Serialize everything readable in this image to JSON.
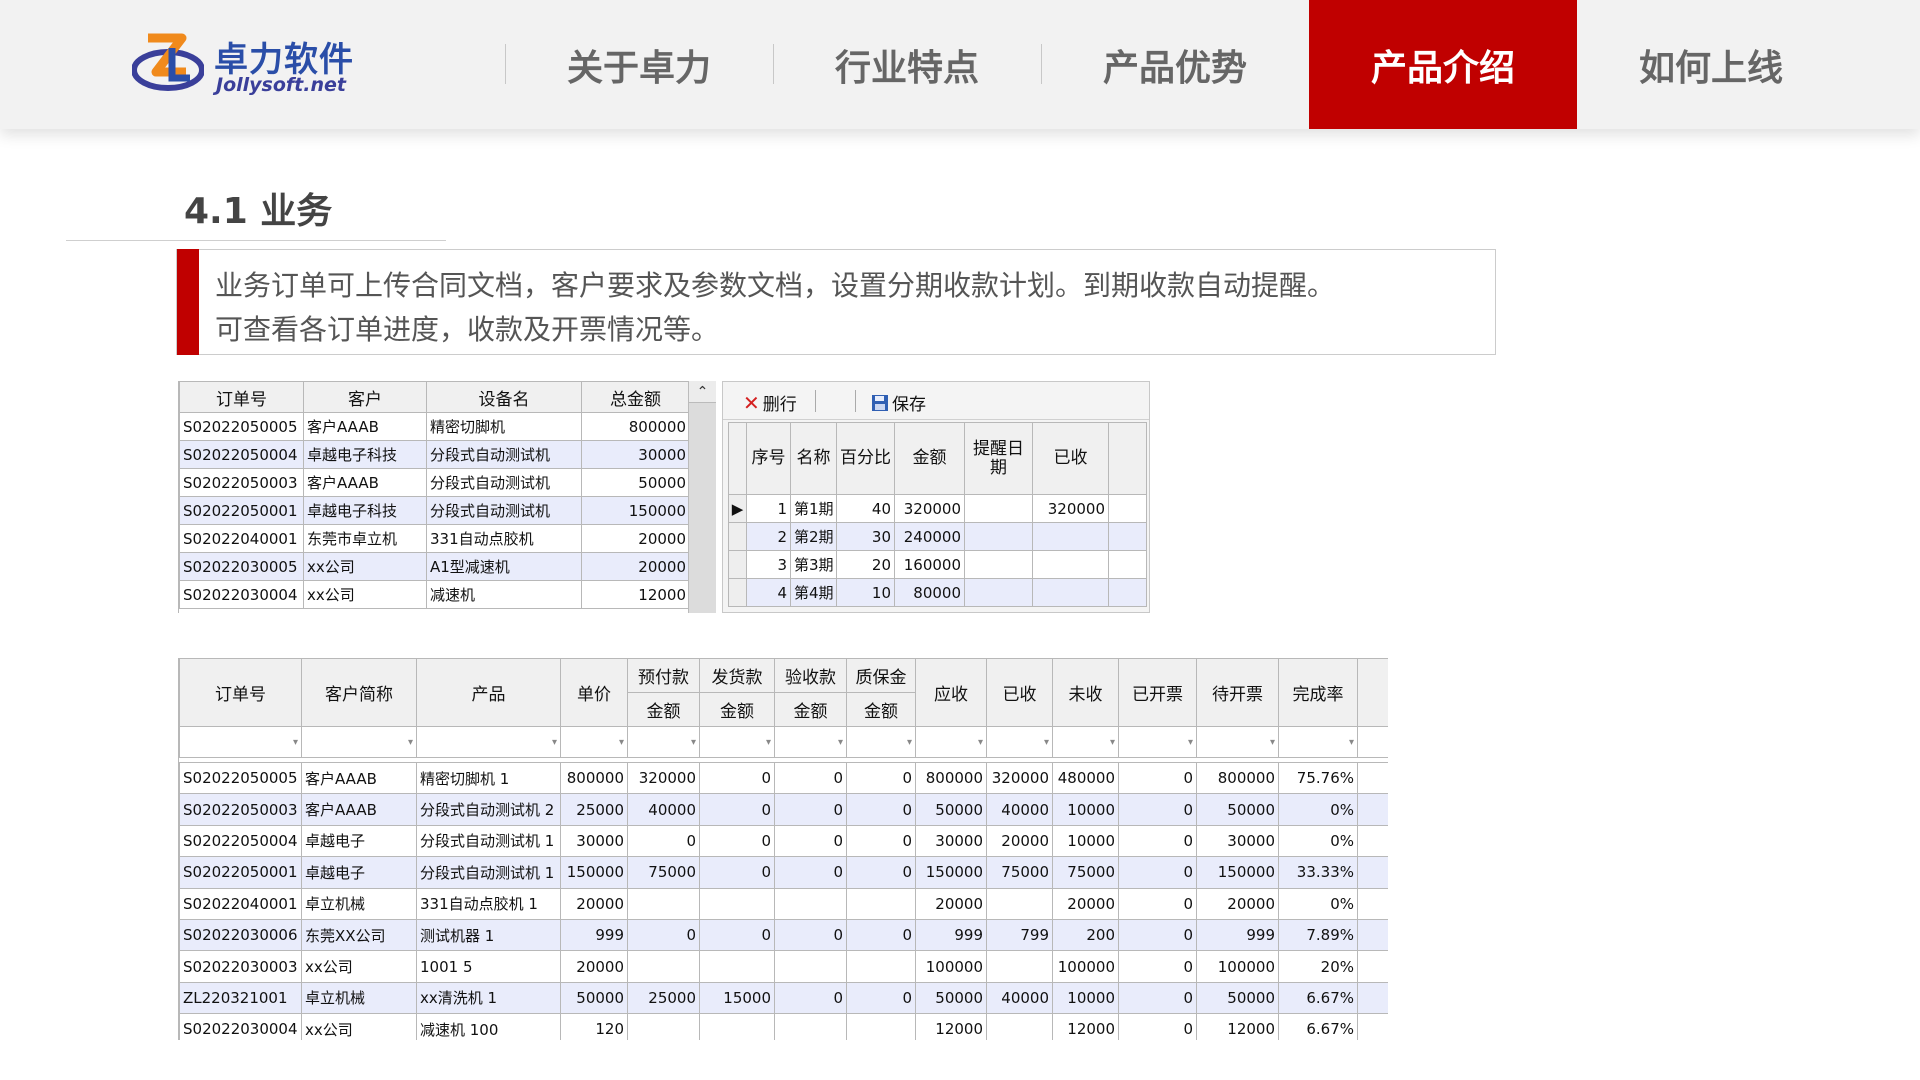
{
  "brand": {
    "name_cn": "卓力软件",
    "name_en": "Jollysoft.net"
  },
  "nav": [
    {
      "label": "关于卓力",
      "active": false
    },
    {
      "label": "行业特点",
      "active": false
    },
    {
      "label": "产品优势",
      "active": false
    },
    {
      "label": "产品介绍",
      "active": true
    },
    {
      "label": "如何上线",
      "active": false
    }
  ],
  "section": {
    "title": "4.1 业务",
    "desc_line1": "业务订单可上传合同文档，客户要求及参数文档，设置分期收款计划。到期收款自动提醒。",
    "desc_line2": "可查看各订单进度，收款及开票情况等。"
  },
  "orders_table": {
    "headers": [
      "订单号",
      "客户",
      "设备名",
      "总金额"
    ],
    "rows": [
      [
        "S02022050005",
        "客户AAAB",
        "精密切脚机",
        "800000"
      ],
      [
        "S02022050004",
        "卓越电子科技",
        "分段式自动测试机",
        "30000"
      ],
      [
        "S02022050003",
        "客户AAAB",
        "分段式自动测试机",
        "50000"
      ],
      [
        "S02022050001",
        "卓越电子科技",
        "分段式自动测试机",
        "150000"
      ],
      [
        "S02022040001",
        "东莞市卓立机",
        "331自动点胶机",
        "20000"
      ],
      [
        "S02022030005",
        "xx公司",
        "A1型减速机",
        "20000"
      ],
      [
        "S02022030004",
        "xx公司",
        "减速机",
        "12000"
      ]
    ]
  },
  "installment_panel": {
    "delete_label": "删行",
    "save_label": "保存",
    "headers": [
      "序号",
      "名称",
      "百分比",
      "金额",
      "提醒日期",
      "已收"
    ],
    "rows": [
      [
        "1",
        "第1期",
        "40",
        "320000",
        "",
        "320000"
      ],
      [
        "2",
        "第2期",
        "30",
        "240000",
        "",
        ""
      ],
      [
        "3",
        "第3期",
        "20",
        "160000",
        "",
        ""
      ],
      [
        "4",
        "第4期",
        "10",
        "80000",
        "",
        ""
      ]
    ]
  },
  "progress_table": {
    "headers": {
      "order_no": "订单号",
      "customer": "客户简称",
      "product": "产品",
      "unit_price": "单价",
      "prepay": "预付款",
      "delivery": "发货款",
      "acceptance": "验收款",
      "warranty": "质保金",
      "amount": "金额",
      "receivable": "应收",
      "received": "已收",
      "unreceived": "未收",
      "invoiced": "已开票",
      "to_invoice": "待开票",
      "completion": "完成率"
    },
    "rows": [
      [
        "S02022050005",
        "客户AAAB",
        "精密切脚机 1",
        "800000",
        "320000",
        "0",
        "0",
        "0",
        "800000",
        "320000",
        "480000",
        "0",
        "800000",
        "75.76%"
      ],
      [
        "S02022050003",
        "客户AAAB",
        "分段式自动测试机 2",
        "25000",
        "40000",
        "0",
        "0",
        "0",
        "50000",
        "40000",
        "10000",
        "0",
        "50000",
        "0%"
      ],
      [
        "S02022050004",
        "卓越电子",
        "分段式自动测试机 1",
        "30000",
        "0",
        "0",
        "0",
        "0",
        "30000",
        "20000",
        "10000",
        "0",
        "30000",
        "0%"
      ],
      [
        "S02022050001",
        "卓越电子",
        "分段式自动测试机 1",
        "150000",
        "75000",
        "0",
        "0",
        "0",
        "150000",
        "75000",
        "75000",
        "0",
        "150000",
        "33.33%"
      ],
      [
        "S02022040001",
        "卓立机械",
        "331自动点胶机 1",
        "20000",
        "",
        "",
        "",
        "",
        "20000",
        "",
        "20000",
        "0",
        "20000",
        "0%"
      ],
      [
        "S02022030006",
        "东莞XX公司",
        "测试机器 1",
        "999",
        "0",
        "0",
        "0",
        "0",
        "999",
        "799",
        "200",
        "0",
        "999",
        "7.89%"
      ],
      [
        "S02022030003",
        "xx公司",
        "1001 5",
        "20000",
        "",
        "",
        "",
        "",
        "100000",
        "",
        "100000",
        "0",
        "100000",
        "20%"
      ],
      [
        "ZL220321001",
        "卓立机械",
        "xx清洗机 1",
        "50000",
        "25000",
        "15000",
        "0",
        "0",
        "50000",
        "40000",
        "10000",
        "0",
        "50000",
        "6.67%"
      ],
      [
        "S02022030004",
        "xx公司",
        "减速机 100",
        "120",
        "",
        "",
        "",
        "",
        "12000",
        "",
        "12000",
        "0",
        "12000",
        "6.67%"
      ]
    ]
  },
  "colors": {
    "accent": "#c00000",
    "header_bg": "#f2f2f2",
    "row_alt": "#e9ecfb"
  }
}
